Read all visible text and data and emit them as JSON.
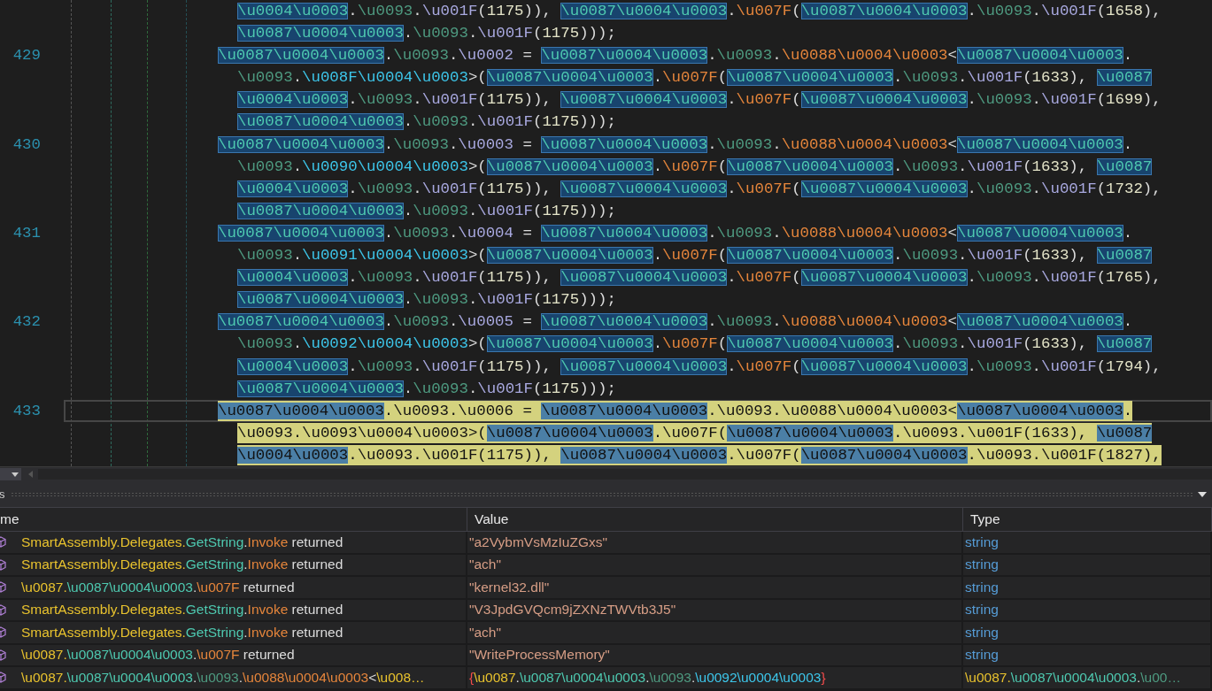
{
  "editor": {
    "lines": [
      {
        "current": false,
        "rows": [
          {
            "tokens": [
              {
                "text": "\\u0004\\u0003",
                "kind": "highlight"
              },
              {
                "text": ".",
                "kind": "plain"
              },
              {
                "text": "\\u0093",
                "kind": "namespace"
              },
              {
                "text": ".",
                "kind": "plain"
              },
              {
                "text": "\\u001F",
                "kind": "member"
              },
              {
                "text": "(",
                "kind": "plain"
              },
              {
                "text": "1175",
                "kind": "number"
              },
              {
                "text": ")), ",
                "kind": "plain"
              },
              {
                "text": "\\u0087\\u0004\\u0003",
                "kind": "highlight"
              },
              {
                "text": ".",
                "kind": "plain"
              },
              {
                "text": "\\u007F",
                "kind": "method"
              },
              {
                "text": "(",
                "kind": "plain"
              },
              {
                "text": "\\u0087\\u0004\\u0003",
                "kind": "highlight"
              },
              {
                "text": ".",
                "kind": "plain"
              },
              {
                "text": "\\u0093",
                "kind": "namespace"
              },
              {
                "text": ".",
                "kind": "plain"
              },
              {
                "text": "\\u001F",
                "kind": "member"
              },
              {
                "text": "(",
                "kind": "plain"
              },
              {
                "text": "1658",
                "kind": "number"
              },
              {
                "text": "),",
                "kind": "plain"
              }
            ]
          },
          {
            "tokens": [
              {
                "text": "\\u0087\\u0004\\u0003",
                "kind": "highlight"
              },
              {
                "text": ".",
                "kind": "plain"
              },
              {
                "text": "\\u0093",
                "kind": "namespace"
              },
              {
                "text": ".",
                "kind": "plain"
              },
              {
                "text": "\\u001F",
                "kind": "member"
              },
              {
                "text": "(",
                "kind": "plain"
              },
              {
                "text": "1175",
                "kind": "number"
              },
              {
                "text": ")));",
                "kind": "plain"
              }
            ]
          }
        ]
      },
      {
        "number": "429",
        "current": false,
        "rows": [
          {
            "tokens": [
              {
                "text": "\\u0087\\u0004\\u0003",
                "kind": "highlight"
              },
              {
                "text": ".",
                "kind": "plain"
              },
              {
                "text": "\\u0093",
                "kind": "namespace"
              },
              {
                "text": ".",
                "kind": "plain"
              },
              {
                "text": "\\u0002",
                "kind": "member"
              },
              {
                "text": " = ",
                "kind": "plain"
              },
              {
                "text": "\\u0087\\u0004\\u0003",
                "kind": "highlight"
              },
              {
                "text": ".",
                "kind": "plain"
              },
              {
                "text": "\\u0093",
                "kind": "namespace"
              },
              {
                "text": ".",
                "kind": "plain"
              },
              {
                "text": "\\u0088\\u0004\\u0003",
                "kind": "method"
              },
              {
                "text": "<",
                "kind": "plain"
              },
              {
                "text": "\\u0087\\u0004\\u0003",
                "kind": "highlight"
              },
              {
                "text": ".",
                "kind": "plain"
              }
            ]
          },
          {
            "tokens": [
              {
                "text": "\\u0093",
                "kind": "namespace"
              },
              {
                "text": ".",
                "kind": "plain"
              },
              {
                "text": "\\u008F\\u0004\\u0003",
                "kind": "generic"
              },
              {
                "text": ">(",
                "kind": "plain"
              },
              {
                "text": "\\u0087\\u0004\\u0003",
                "kind": "highlight"
              },
              {
                "text": ".",
                "kind": "plain"
              },
              {
                "text": "\\u007F",
                "kind": "method"
              },
              {
                "text": "(",
                "kind": "plain"
              },
              {
                "text": "\\u0087\\u0004\\u0003",
                "kind": "highlight"
              },
              {
                "text": ".",
                "kind": "plain"
              },
              {
                "text": "\\u0093",
                "kind": "namespace"
              },
              {
                "text": ".",
                "kind": "plain"
              },
              {
                "text": "\\u001F",
                "kind": "member"
              },
              {
                "text": "(",
                "kind": "plain"
              },
              {
                "text": "1633",
                "kind": "number"
              },
              {
                "text": "), ",
                "kind": "plain"
              },
              {
                "text": "\\u0087",
                "kind": "highlight"
              }
            ]
          },
          {
            "tokens": [
              {
                "text": "\\u0004\\u0003",
                "kind": "highlight"
              },
              {
                "text": ".",
                "kind": "plain"
              },
              {
                "text": "\\u0093",
                "kind": "namespace"
              },
              {
                "text": ".",
                "kind": "plain"
              },
              {
                "text": "\\u001F",
                "kind": "member"
              },
              {
                "text": "(",
                "kind": "plain"
              },
              {
                "text": "1175",
                "kind": "number"
              },
              {
                "text": ")), ",
                "kind": "plain"
              },
              {
                "text": "\\u0087\\u0004\\u0003",
                "kind": "highlight"
              },
              {
                "text": ".",
                "kind": "plain"
              },
              {
                "text": "\\u007F",
                "kind": "method"
              },
              {
                "text": "(",
                "kind": "plain"
              },
              {
                "text": "\\u0087\\u0004\\u0003",
                "kind": "highlight"
              },
              {
                "text": ".",
                "kind": "plain"
              },
              {
                "text": "\\u0093",
                "kind": "namespace"
              },
              {
                "text": ".",
                "kind": "plain"
              },
              {
                "text": "\\u001F",
                "kind": "member"
              },
              {
                "text": "(",
                "kind": "plain"
              },
              {
                "text": "1699",
                "kind": "number"
              },
              {
                "text": "),",
                "kind": "plain"
              }
            ]
          },
          {
            "tokens": [
              {
                "text": "\\u0087\\u0004\\u0003",
                "kind": "highlight"
              },
              {
                "text": ".",
                "kind": "plain"
              },
              {
                "text": "\\u0093",
                "kind": "namespace"
              },
              {
                "text": ".",
                "kind": "plain"
              },
              {
                "text": "\\u001F",
                "kind": "member"
              },
              {
                "text": "(",
                "kind": "plain"
              },
              {
                "text": "1175",
                "kind": "number"
              },
              {
                "text": ")));",
                "kind": "plain"
              }
            ]
          }
        ]
      },
      {
        "number": "430",
        "current": false,
        "rows": [
          {
            "tokens": [
              {
                "text": "\\u0087\\u0004\\u0003",
                "kind": "highlight"
              },
              {
                "text": ".",
                "kind": "plain"
              },
              {
                "text": "\\u0093",
                "kind": "namespace"
              },
              {
                "text": ".",
                "kind": "plain"
              },
              {
                "text": "\\u0003",
                "kind": "member"
              },
              {
                "text": " = ",
                "kind": "plain"
              },
              {
                "text": "\\u0087\\u0004\\u0003",
                "kind": "highlight"
              },
              {
                "text": ".",
                "kind": "plain"
              },
              {
                "text": "\\u0093",
                "kind": "namespace"
              },
              {
                "text": ".",
                "kind": "plain"
              },
              {
                "text": "\\u0088\\u0004\\u0003",
                "kind": "method"
              },
              {
                "text": "<",
                "kind": "plain"
              },
              {
                "text": "\\u0087\\u0004\\u0003",
                "kind": "highlight"
              },
              {
                "text": ".",
                "kind": "plain"
              }
            ]
          },
          {
            "tokens": [
              {
                "text": "\\u0093",
                "kind": "namespace"
              },
              {
                "text": ".",
                "kind": "plain"
              },
              {
                "text": "\\u0090\\u0004\\u0003",
                "kind": "generic"
              },
              {
                "text": ">(",
                "kind": "plain"
              },
              {
                "text": "\\u0087\\u0004\\u0003",
                "kind": "highlight"
              },
              {
                "text": ".",
                "kind": "plain"
              },
              {
                "text": "\\u007F",
                "kind": "method"
              },
              {
                "text": "(",
                "kind": "plain"
              },
              {
                "text": "\\u0087\\u0004\\u0003",
                "kind": "highlight"
              },
              {
                "text": ".",
                "kind": "plain"
              },
              {
                "text": "\\u0093",
                "kind": "namespace"
              },
              {
                "text": ".",
                "kind": "plain"
              },
              {
                "text": "\\u001F",
                "kind": "member"
              },
              {
                "text": "(",
                "kind": "plain"
              },
              {
                "text": "1633",
                "kind": "number"
              },
              {
                "text": "), ",
                "kind": "plain"
              },
              {
                "text": "\\u0087",
                "kind": "highlight"
              }
            ]
          },
          {
            "tokens": [
              {
                "text": "\\u0004\\u0003",
                "kind": "highlight"
              },
              {
                "text": ".",
                "kind": "plain"
              },
              {
                "text": "\\u0093",
                "kind": "namespace"
              },
              {
                "text": ".",
                "kind": "plain"
              },
              {
                "text": "\\u001F",
                "kind": "member"
              },
              {
                "text": "(",
                "kind": "plain"
              },
              {
                "text": "1175",
                "kind": "number"
              },
              {
                "text": ")), ",
                "kind": "plain"
              },
              {
                "text": "\\u0087\\u0004\\u0003",
                "kind": "highlight"
              },
              {
                "text": ".",
                "kind": "plain"
              },
              {
                "text": "\\u007F",
                "kind": "method"
              },
              {
                "text": "(",
                "kind": "plain"
              },
              {
                "text": "\\u0087\\u0004\\u0003",
                "kind": "highlight"
              },
              {
                "text": ".",
                "kind": "plain"
              },
              {
                "text": "\\u0093",
                "kind": "namespace"
              },
              {
                "text": ".",
                "kind": "plain"
              },
              {
                "text": "\\u001F",
                "kind": "member"
              },
              {
                "text": "(",
                "kind": "plain"
              },
              {
                "text": "1732",
                "kind": "number"
              },
              {
                "text": "),",
                "kind": "plain"
              }
            ]
          },
          {
            "tokens": [
              {
                "text": "\\u0087\\u0004\\u0003",
                "kind": "highlight"
              },
              {
                "text": ".",
                "kind": "plain"
              },
              {
                "text": "\\u0093",
                "kind": "namespace"
              },
              {
                "text": ".",
                "kind": "plain"
              },
              {
                "text": "\\u001F",
                "kind": "member"
              },
              {
                "text": "(",
                "kind": "plain"
              },
              {
                "text": "1175",
                "kind": "number"
              },
              {
                "text": ")));",
                "kind": "plain"
              }
            ]
          }
        ]
      },
      {
        "number": "431",
        "current": false,
        "rows": [
          {
            "tokens": [
              {
                "text": "\\u0087\\u0004\\u0003",
                "kind": "highlight"
              },
              {
                "text": ".",
                "kind": "plain"
              },
              {
                "text": "\\u0093",
                "kind": "namespace"
              },
              {
                "text": ".",
                "kind": "plain"
              },
              {
                "text": "\\u0004",
                "kind": "member"
              },
              {
                "text": " = ",
                "kind": "plain"
              },
              {
                "text": "\\u0087\\u0004\\u0003",
                "kind": "highlight"
              },
              {
                "text": ".",
                "kind": "plain"
              },
              {
                "text": "\\u0093",
                "kind": "namespace"
              },
              {
                "text": ".",
                "kind": "plain"
              },
              {
                "text": "\\u0088\\u0004\\u0003",
                "kind": "method"
              },
              {
                "text": "<",
                "kind": "plain"
              },
              {
                "text": "\\u0087\\u0004\\u0003",
                "kind": "highlight"
              },
              {
                "text": ".",
                "kind": "plain"
              }
            ]
          },
          {
            "tokens": [
              {
                "text": "\\u0093",
                "kind": "namespace"
              },
              {
                "text": ".",
                "kind": "plain"
              },
              {
                "text": "\\u0091\\u0004\\u0003",
                "kind": "generic"
              },
              {
                "text": ">(",
                "kind": "plain"
              },
              {
                "text": "\\u0087\\u0004\\u0003",
                "kind": "highlight"
              },
              {
                "text": ".",
                "kind": "plain"
              },
              {
                "text": "\\u007F",
                "kind": "method"
              },
              {
                "text": "(",
                "kind": "plain"
              },
              {
                "text": "\\u0087\\u0004\\u0003",
                "kind": "highlight"
              },
              {
                "text": ".",
                "kind": "plain"
              },
              {
                "text": "\\u0093",
                "kind": "namespace"
              },
              {
                "text": ".",
                "kind": "plain"
              },
              {
                "text": "\\u001F",
                "kind": "member"
              },
              {
                "text": "(",
                "kind": "plain"
              },
              {
                "text": "1633",
                "kind": "number"
              },
              {
                "text": "), ",
                "kind": "plain"
              },
              {
                "text": "\\u0087",
                "kind": "highlight"
              }
            ]
          },
          {
            "tokens": [
              {
                "text": "\\u0004\\u0003",
                "kind": "highlight"
              },
              {
                "text": ".",
                "kind": "plain"
              },
              {
                "text": "\\u0093",
                "kind": "namespace"
              },
              {
                "text": ".",
                "kind": "plain"
              },
              {
                "text": "\\u001F",
                "kind": "member"
              },
              {
                "text": "(",
                "kind": "plain"
              },
              {
                "text": "1175",
                "kind": "number"
              },
              {
                "text": ")), ",
                "kind": "plain"
              },
              {
                "text": "\\u0087\\u0004\\u0003",
                "kind": "highlight"
              },
              {
                "text": ".",
                "kind": "plain"
              },
              {
                "text": "\\u007F",
                "kind": "method"
              },
              {
                "text": "(",
                "kind": "plain"
              },
              {
                "text": "\\u0087\\u0004\\u0003",
                "kind": "highlight"
              },
              {
                "text": ".",
                "kind": "plain"
              },
              {
                "text": "\\u0093",
                "kind": "namespace"
              },
              {
                "text": ".",
                "kind": "plain"
              },
              {
                "text": "\\u001F",
                "kind": "member"
              },
              {
                "text": "(",
                "kind": "plain"
              },
              {
                "text": "1765",
                "kind": "number"
              },
              {
                "text": "),",
                "kind": "plain"
              }
            ]
          },
          {
            "tokens": [
              {
                "text": "\\u0087\\u0004\\u0003",
                "kind": "highlight"
              },
              {
                "text": ".",
                "kind": "plain"
              },
              {
                "text": "\\u0093",
                "kind": "namespace"
              },
              {
                "text": ".",
                "kind": "plain"
              },
              {
                "text": "\\u001F",
                "kind": "member"
              },
              {
                "text": "(",
                "kind": "plain"
              },
              {
                "text": "1175",
                "kind": "number"
              },
              {
                "text": ")));",
                "kind": "plain"
              }
            ]
          }
        ]
      },
      {
        "number": "432",
        "current": false,
        "rows": [
          {
            "tokens": [
              {
                "text": "\\u0087\\u0004\\u0003",
                "kind": "highlight"
              },
              {
                "text": ".",
                "kind": "plain"
              },
              {
                "text": "\\u0093",
                "kind": "namespace"
              },
              {
                "text": ".",
                "kind": "plain"
              },
              {
                "text": "\\u0005",
                "kind": "member"
              },
              {
                "text": " = ",
                "kind": "plain"
              },
              {
                "text": "\\u0087\\u0004\\u0003",
                "kind": "highlight"
              },
              {
                "text": ".",
                "kind": "plain"
              },
              {
                "text": "\\u0093",
                "kind": "namespace"
              },
              {
                "text": ".",
                "kind": "plain"
              },
              {
                "text": "\\u0088\\u0004\\u0003",
                "kind": "method"
              },
              {
                "text": "<",
                "kind": "plain"
              },
              {
                "text": "\\u0087\\u0004\\u0003",
                "kind": "highlight"
              },
              {
                "text": ".",
                "kind": "plain"
              }
            ]
          },
          {
            "tokens": [
              {
                "text": "\\u0093",
                "kind": "namespace"
              },
              {
                "text": ".",
                "kind": "plain"
              },
              {
                "text": "\\u0092\\u0004\\u0003",
                "kind": "generic"
              },
              {
                "text": ">(",
                "kind": "plain"
              },
              {
                "text": "\\u0087\\u0004\\u0003",
                "kind": "highlight"
              },
              {
                "text": ".",
                "kind": "plain"
              },
              {
                "text": "\\u007F",
                "kind": "method"
              },
              {
                "text": "(",
                "kind": "plain"
              },
              {
                "text": "\\u0087\\u0004\\u0003",
                "kind": "highlight"
              },
              {
                "text": ".",
                "kind": "plain"
              },
              {
                "text": "\\u0093",
                "kind": "namespace"
              },
              {
                "text": ".",
                "kind": "plain"
              },
              {
                "text": "\\u001F",
                "kind": "member"
              },
              {
                "text": "(",
                "kind": "plain"
              },
              {
                "text": "1633",
                "kind": "number"
              },
              {
                "text": "), ",
                "kind": "plain"
              },
              {
                "text": "\\u0087",
                "kind": "highlight"
              }
            ]
          },
          {
            "tokens": [
              {
                "text": "\\u0004\\u0003",
                "kind": "highlight"
              },
              {
                "text": ".",
                "kind": "plain"
              },
              {
                "text": "\\u0093",
                "kind": "namespace"
              },
              {
                "text": ".",
                "kind": "plain"
              },
              {
                "text": "\\u001F",
                "kind": "member"
              },
              {
                "text": "(",
                "kind": "plain"
              },
              {
                "text": "1175",
                "kind": "number"
              },
              {
                "text": ")), ",
                "kind": "plain"
              },
              {
                "text": "\\u0087\\u0004\\u0003",
                "kind": "highlight"
              },
              {
                "text": ".",
                "kind": "plain"
              },
              {
                "text": "\\u007F",
                "kind": "method"
              },
              {
                "text": "(",
                "kind": "plain"
              },
              {
                "text": "\\u0087\\u0004\\u0003",
                "kind": "highlight"
              },
              {
                "text": ".",
                "kind": "plain"
              },
              {
                "text": "\\u0093",
                "kind": "namespace"
              },
              {
                "text": ".",
                "kind": "plain"
              },
              {
                "text": "\\u001F",
                "kind": "member"
              },
              {
                "text": "(",
                "kind": "plain"
              },
              {
                "text": "1794",
                "kind": "number"
              },
              {
                "text": "),",
                "kind": "plain"
              }
            ]
          },
          {
            "tokens": [
              {
                "text": "\\u0087\\u0004\\u0003",
                "kind": "highlight"
              },
              {
                "text": ".",
                "kind": "plain"
              },
              {
                "text": "\\u0093",
                "kind": "namespace"
              },
              {
                "text": ".",
                "kind": "plain"
              },
              {
                "text": "\\u001F",
                "kind": "member"
              },
              {
                "text": "(",
                "kind": "plain"
              },
              {
                "text": "1175",
                "kind": "number"
              },
              {
                "text": ")));",
                "kind": "plain"
              }
            ]
          }
        ]
      },
      {
        "number": "433",
        "current": true,
        "rows": [
          {
            "tokens": [
              {
                "text": "\\u0087\\u0004\\u0003",
                "kind": "highlight"
              },
              {
                "text": ".",
                "kind": "plain"
              },
              {
                "text": "\\u0093",
                "kind": "namespace"
              },
              {
                "text": ".",
                "kind": "plain"
              },
              {
                "text": "\\u0006",
                "kind": "member"
              },
              {
                "text": " = ",
                "kind": "plain"
              },
              {
                "text": "\\u0087\\u0004\\u0003",
                "kind": "highlight"
              },
              {
                "text": ".",
                "kind": "plain"
              },
              {
                "text": "\\u0093",
                "kind": "namespace"
              },
              {
                "text": ".",
                "kind": "plain"
              },
              {
                "text": "\\u0088\\u0004\\u0003",
                "kind": "method"
              },
              {
                "text": "<",
                "kind": "plain"
              },
              {
                "text": "\\u0087\\u0004\\u0003",
                "kind": "highlight"
              },
              {
                "text": ".",
                "kind": "plain"
              }
            ]
          },
          {
            "tokens": [
              {
                "text": "\\u0093",
                "kind": "namespace"
              },
              {
                "text": ".",
                "kind": "plain"
              },
              {
                "text": "\\u0093\\u0004\\u0003",
                "kind": "generic"
              },
              {
                "text": ">(",
                "kind": "plain"
              },
              {
                "text": "\\u0087\\u0004\\u0003",
                "kind": "highlight"
              },
              {
                "text": ".",
                "kind": "plain"
              },
              {
                "text": "\\u007F",
                "kind": "method"
              },
              {
                "text": "(",
                "kind": "plain"
              },
              {
                "text": "\\u0087\\u0004\\u0003",
                "kind": "highlight"
              },
              {
                "text": ".",
                "kind": "plain"
              },
              {
                "text": "\\u0093",
                "kind": "namespace"
              },
              {
                "text": ".",
                "kind": "plain"
              },
              {
                "text": "\\u001F",
                "kind": "member"
              },
              {
                "text": "(",
                "kind": "plain"
              },
              {
                "text": "1633",
                "kind": "number"
              },
              {
                "text": "), ",
                "kind": "plain"
              },
              {
                "text": "\\u0087",
                "kind": "highlight"
              }
            ]
          },
          {
            "tokens": [
              {
                "text": "\\u0004\\u0003",
                "kind": "highlight"
              },
              {
                "text": ".",
                "kind": "plain"
              },
              {
                "text": "\\u0093",
                "kind": "namespace"
              },
              {
                "text": ".",
                "kind": "plain"
              },
              {
                "text": "\\u001F",
                "kind": "member"
              },
              {
                "text": "(",
                "kind": "plain"
              },
              {
                "text": "1175",
                "kind": "number"
              },
              {
                "text": ")), ",
                "kind": "plain"
              },
              {
                "text": "\\u0087\\u0004\\u0003",
                "kind": "highlight"
              },
              {
                "text": ".",
                "kind": "plain"
              },
              {
                "text": "\\u007F",
                "kind": "method"
              },
              {
                "text": "(",
                "kind": "plain"
              },
              {
                "text": "\\u0087\\u0004\\u0003",
                "kind": "highlight"
              },
              {
                "text": ".",
                "kind": "plain"
              },
              {
                "text": "\\u0093",
                "kind": "namespace"
              },
              {
                "text": ".",
                "kind": "plain"
              },
              {
                "text": "\\u001F",
                "kind": "member"
              },
              {
                "text": "(",
                "kind": "plain"
              },
              {
                "text": "1827",
                "kind": "number"
              },
              {
                "text": "),",
                "kind": "plain"
              }
            ]
          }
        ]
      }
    ]
  },
  "panel": {
    "title": "s",
    "columns": [
      "me",
      "Value",
      "Type"
    ],
    "rows": [
      {
        "name": [
          {
            "text": "SmartAssembly.Delegates.",
            "kind": "class"
          },
          {
            "text": "GetString",
            "kind": "type"
          },
          {
            "text": ".",
            "kind": "plain"
          },
          {
            "text": "Invoke",
            "kind": "method"
          },
          {
            "text": " returned",
            "kind": "plain"
          }
        ],
        "value": [
          {
            "text": "\"a2VybmVsMzIuZGxs\"",
            "kind": "string"
          }
        ],
        "type": [
          {
            "text": "string",
            "kind": "keyword"
          }
        ]
      },
      {
        "name": [
          {
            "text": "SmartAssembly.Delegates.",
            "kind": "class"
          },
          {
            "text": "GetString",
            "kind": "type"
          },
          {
            "text": ".",
            "kind": "plain"
          },
          {
            "text": "Invoke",
            "kind": "method"
          },
          {
            "text": " returned",
            "kind": "plain"
          }
        ],
        "value": [
          {
            "text": "\"ach\"",
            "kind": "string"
          }
        ],
        "type": [
          {
            "text": "string",
            "kind": "keyword"
          }
        ]
      },
      {
        "name": [
          {
            "text": "\\u0087.",
            "kind": "class"
          },
          {
            "text": "\\u0087\\u0004\\u0003",
            "kind": "type"
          },
          {
            "text": ".",
            "kind": "plain"
          },
          {
            "text": "\\u007F",
            "kind": "method"
          },
          {
            "text": " returned",
            "kind": "plain"
          }
        ],
        "value": [
          {
            "text": "\"kernel32.dll\"",
            "kind": "string"
          }
        ],
        "type": [
          {
            "text": "string",
            "kind": "keyword"
          }
        ]
      },
      {
        "name": [
          {
            "text": "SmartAssembly.Delegates.",
            "kind": "class"
          },
          {
            "text": "GetString",
            "kind": "type"
          },
          {
            "text": ".",
            "kind": "plain"
          },
          {
            "text": "Invoke",
            "kind": "method"
          },
          {
            "text": " returned",
            "kind": "plain"
          }
        ],
        "value": [
          {
            "text": "\"V3JpdGVQcm9jZXNzTWVtb3J5\"",
            "kind": "string"
          }
        ],
        "type": [
          {
            "text": "string",
            "kind": "keyword"
          }
        ]
      },
      {
        "name": [
          {
            "text": "SmartAssembly.Delegates.",
            "kind": "class"
          },
          {
            "text": "GetString",
            "kind": "type"
          },
          {
            "text": ".",
            "kind": "plain"
          },
          {
            "text": "Invoke",
            "kind": "method"
          },
          {
            "text": " returned",
            "kind": "plain"
          }
        ],
        "value": [
          {
            "text": "\"ach\"",
            "kind": "string"
          }
        ],
        "type": [
          {
            "text": "string",
            "kind": "keyword"
          }
        ]
      },
      {
        "name": [
          {
            "text": "\\u0087.",
            "kind": "class"
          },
          {
            "text": "\\u0087\\u0004\\u0003",
            "kind": "type"
          },
          {
            "text": ".",
            "kind": "plain"
          },
          {
            "text": "\\u007F",
            "kind": "method"
          },
          {
            "text": " returned",
            "kind": "plain"
          }
        ],
        "value": [
          {
            "text": "\"WriteProcessMemory\"",
            "kind": "string"
          }
        ],
        "type": [
          {
            "text": "string",
            "kind": "keyword"
          }
        ]
      },
      {
        "name": [
          {
            "text": "\\u0087.",
            "kind": "class"
          },
          {
            "text": "\\u0087\\u0004\\u0003",
            "kind": "type"
          },
          {
            "text": ".",
            "kind": "plain"
          },
          {
            "text": "\\u0093",
            "kind": "namespace"
          },
          {
            "text": ".",
            "kind": "plain"
          },
          {
            "text": "\\u0088\\u0004\\u0003",
            "kind": "method"
          },
          {
            "text": "<",
            "kind": "plain"
          },
          {
            "text": "\\u008…",
            "kind": "class"
          }
        ],
        "value": [
          {
            "text": "{",
            "kind": "brace"
          },
          {
            "text": "\\u0087",
            "kind": "class"
          },
          {
            "text": ".",
            "kind": "plain"
          },
          {
            "text": "\\u0087\\u0004\\u0003",
            "kind": "type"
          },
          {
            "text": ".",
            "kind": "plain"
          },
          {
            "text": "\\u0093",
            "kind": "namespace"
          },
          {
            "text": ".",
            "kind": "plain"
          },
          {
            "text": "\\u0092\\u0004\\u0003",
            "kind": "generic"
          },
          {
            "text": "}",
            "kind": "brace"
          }
        ],
        "type": [
          {
            "text": "\\u0087.",
            "kind": "class"
          },
          {
            "text": "\\u0087\\u0004\\u0003",
            "kind": "type"
          },
          {
            "text": ".",
            "kind": "plain"
          },
          {
            "text": "\\u00…",
            "kind": "namespace"
          }
        ]
      }
    ]
  }
}
